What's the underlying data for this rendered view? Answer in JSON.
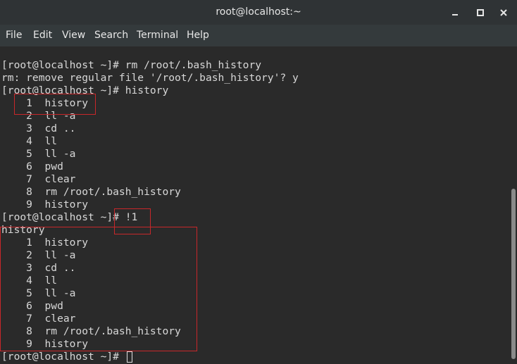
{
  "window": {
    "title": "root@localhost:~"
  },
  "menu": {
    "file": "File",
    "edit": "Edit",
    "view": "View",
    "search": "Search",
    "terminal": "Terminal",
    "help": "Help"
  },
  "terminal": {
    "lines": [
      "",
      "[root@localhost ~]# rm /root/.bash_history",
      "rm: remove regular file '/root/.bash_history'? y",
      "[root@localhost ~]# history",
      "    1  history",
      "    2  ll -a",
      "    3  cd ..",
      "    4  ll",
      "    5  ll -a",
      "    6  pwd",
      "    7  clear",
      "    8  rm /root/.bash_history",
      "    9  history",
      "[root@localhost ~]# !1",
      "history",
      "    1  history",
      "    2  ll -a",
      "    3  cd ..",
      "    4  ll",
      "    5  ll -a",
      "    6  pwd",
      "    7  clear",
      "    8  rm /root/.bash_history",
      "    9  history",
      "[root@localhost ~]# "
    ]
  },
  "colors": {
    "terminal_bg": "#2a2a2a",
    "terminal_fg": "#d8d8d8",
    "annotation": "#c8272a",
    "titlebar_bg": "#2f3335"
  },
  "icons": {
    "minimize": "minimize-icon",
    "maximize": "maximize-icon",
    "close": "close-icon"
  }
}
